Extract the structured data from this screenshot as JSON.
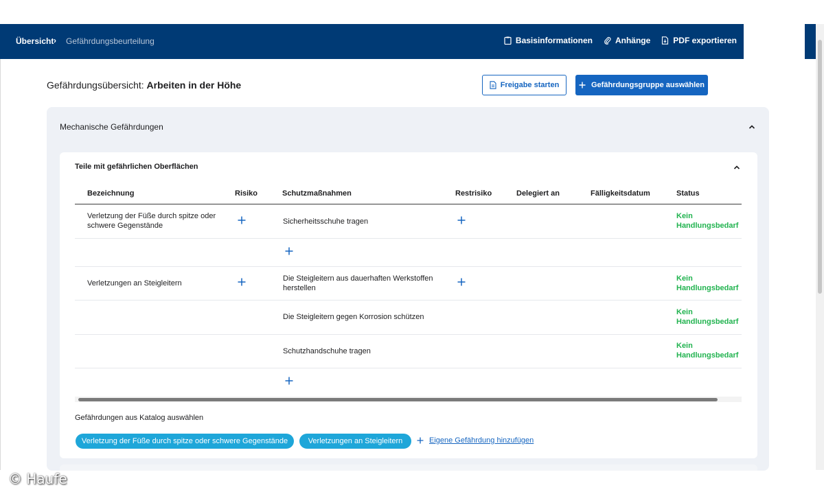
{
  "breadcrumb": {
    "home": "Übersicht",
    "separator": "›",
    "current": "Gefährdungsbeurteilung"
  },
  "topnav": [
    {
      "label": "Basisinformationen",
      "icon": "clipboard-icon"
    },
    {
      "label": "Anhänge",
      "icon": "paperclip-icon"
    },
    {
      "label": "PDF exportieren",
      "icon": "pdf-file-icon"
    }
  ],
  "page": {
    "title_prefix": "Gefährdungsübersicht:",
    "title_subject": "Arbeiten in der Höhe"
  },
  "buttons": {
    "release": "Freigabe starten",
    "select_group": "Gefährdungsgruppe auswählen"
  },
  "group": {
    "title": "Mechanische Gefährdungen"
  },
  "card": {
    "title": "Teile mit gefährlichen Oberflächen"
  },
  "table": {
    "headers": [
      "Bezeichnung",
      "Risiko",
      "Schutzmaßnahmen",
      "Restrisiko",
      "Delegiert an",
      "Fälligkeitsdatum",
      "Status"
    ],
    "rows": [
      {
        "hazard": "Verletzung der Füße durch spitze oder schwere Gegenstände",
        "measure": "Sicherheitsschuhe tragen",
        "status_line1": "Kein",
        "status_line2": "Handlungsbedarf"
      },
      {
        "hazard": "Verletzungen an Steigleitern",
        "measure": "Die Steigleitern aus dauerhaften Werkstoffen herstellen",
        "status_line1": "Kein",
        "status_line2": "Handlungsbedarf"
      },
      {
        "hazard": "",
        "measure": "Die Steigleitern gegen Korrosion schützen",
        "status_line1": "Kein",
        "status_line2": "Handlungsbedarf"
      },
      {
        "hazard": "",
        "measure": "Schutzhandschuhe tragen",
        "status_line1": "Kein",
        "status_line2": "Handlungsbedarf"
      }
    ]
  },
  "catalog": {
    "label": "Gefährdungen aus Katalog auswählen",
    "pills": [
      "Verletzung der Füße durch spitze oder schwere Gegenstände",
      "Verletzungen an Steigleitern"
    ],
    "add_own": "Eigene Gefährdung hinzufügen"
  },
  "watermark": "© Haufe",
  "colors": {
    "header_bg": "#003a75",
    "primary": "#1565c0",
    "status_green": "#21b34f",
    "pill": "#1ea6d9"
  }
}
